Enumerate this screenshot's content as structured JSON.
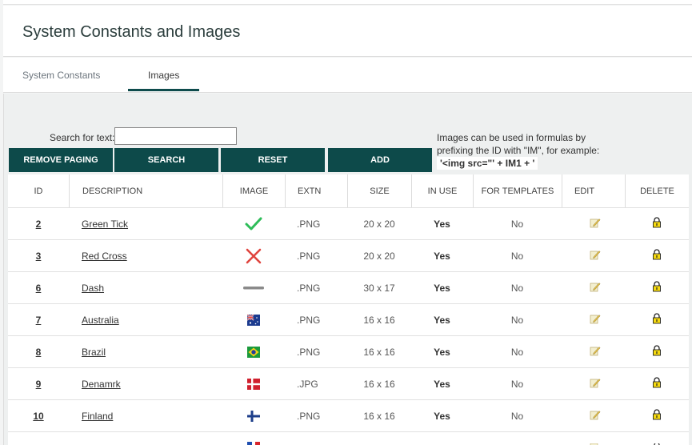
{
  "page": {
    "title": "System Constants and Images"
  },
  "tabs": [
    {
      "label": "System Constants"
    },
    {
      "label": "Images"
    }
  ],
  "search": {
    "label": "Search for text:",
    "value": "",
    "placeholder": ""
  },
  "buttons": {
    "remove_paging": "REMOVE PAGING",
    "search": "SEARCH",
    "reset": "RESET",
    "add": "ADD"
  },
  "note": {
    "text": "Images can be used in formulas by prefixing the ID with \"IM\", for example:",
    "code": "'<img src=\"' + IM1 + '"
  },
  "table": {
    "headers": {
      "id": "ID",
      "description": "DESCRIPTION",
      "image": "IMAGE",
      "extn": "EXTN",
      "size": "SIZE",
      "in_use": "IN USE",
      "for_templates": "FOR TEMPLATES",
      "edit": "EDIT",
      "delete": "DELETE"
    },
    "rows": [
      {
        "id": "2",
        "description": "Green Tick",
        "icon": "green-tick-icon",
        "extn": ".PNG",
        "size": "20 x 20",
        "in_use": "Yes",
        "for_templates": "No"
      },
      {
        "id": "3",
        "description": "Red Cross",
        "icon": "red-cross-icon",
        "extn": ".PNG",
        "size": "20 x 20",
        "in_use": "Yes",
        "for_templates": "No"
      },
      {
        "id": "6",
        "description": "Dash",
        "icon": "dash-icon",
        "extn": ".PNG",
        "size": "30 x 17",
        "in_use": "Yes",
        "for_templates": "No"
      },
      {
        "id": "7",
        "description": "Australia",
        "icon": "australia-flag-icon",
        "extn": ".PNG",
        "size": "16 x 16",
        "in_use": "Yes",
        "for_templates": "No"
      },
      {
        "id": "8",
        "description": "Brazil",
        "icon": "brazil-flag-icon",
        "extn": ".PNG",
        "size": "16 x 16",
        "in_use": "Yes",
        "for_templates": "No"
      },
      {
        "id": "9",
        "description": "Denamrk",
        "icon": "denmark-flag-icon",
        "extn": ".JPG",
        "size": "16 x 16",
        "in_use": "Yes",
        "for_templates": "No"
      },
      {
        "id": "10",
        "description": "Finland",
        "icon": "finland-flag-icon",
        "extn": ".PNG",
        "size": "16 x 16",
        "in_use": "Yes",
        "for_templates": "No"
      }
    ]
  },
  "colors": {
    "accent": "#0d4a4a",
    "tick": "#2ebd59",
    "cross": "#e0443e"
  }
}
